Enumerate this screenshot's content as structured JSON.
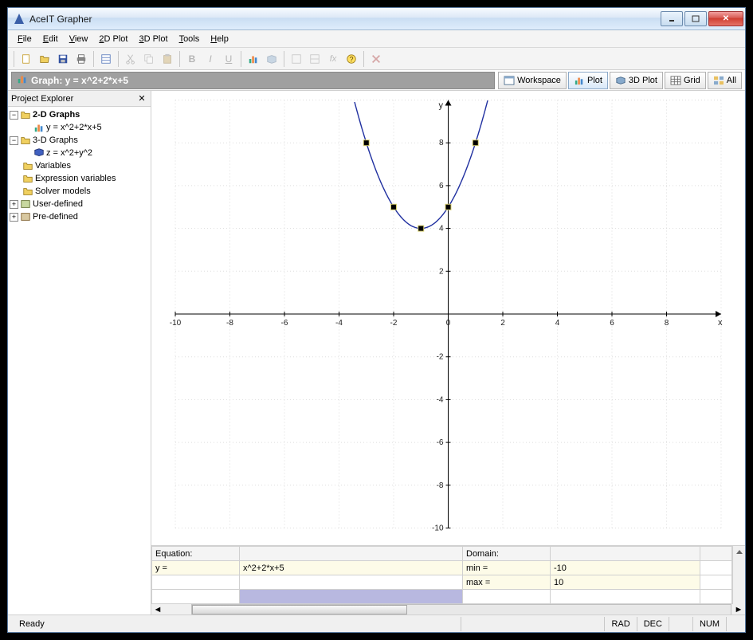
{
  "window": {
    "title": "AceIT Grapher"
  },
  "menu": {
    "file": "File",
    "edit": "Edit",
    "view": "View",
    "plot2d": "2D Plot",
    "plot3d": "3D Plot",
    "tools": "Tools",
    "help": "Help"
  },
  "graph_header": {
    "label": "Graph: y = x^2+2*x+5"
  },
  "view_buttons": {
    "workspace": "Workspace",
    "plot": "Plot",
    "plot3d": "3D Plot",
    "grid": "Grid",
    "all": "All"
  },
  "sidebar": {
    "title": "Project Explorer",
    "nodes": {
      "g2d": "2-D Graphs",
      "eq1": "y = x^2+2*x+5",
      "g3d": "3-D Graphs",
      "eq2": "z = x^2+y^2",
      "vars": "Variables",
      "expvars": "Expression variables",
      "solver": "Solver models",
      "userdef": "User-defined",
      "predef": "Pre-defined"
    }
  },
  "equation_panel": {
    "eq_label": "Equation:",
    "y_label": "y =",
    "expression": "x^2+2*x+5",
    "domain_label": "Domain:",
    "min_label": "min =",
    "min_value": "-10",
    "max_label": "max =",
    "max_value": "10"
  },
  "status": {
    "ready": "Ready",
    "rad": "RAD",
    "dec": "DEC",
    "num": "NUM"
  },
  "chart_data": {
    "type": "line",
    "title": "",
    "xlabel": "x",
    "ylabel": "y",
    "xlim": [
      -10,
      10
    ],
    "ylim": [
      -10,
      10
    ],
    "x_ticks": [
      -10,
      -8,
      -6,
      -4,
      -2,
      0,
      2,
      4,
      6,
      8
    ],
    "y_ticks": [
      -10,
      -8,
      -6,
      -4,
      -2,
      2,
      4,
      6,
      8
    ],
    "series": [
      {
        "name": "y = x^2+2*x+5",
        "function": "x^2+2*x+5",
        "color": "#2030a0"
      }
    ],
    "control_points": [
      {
        "x": -3,
        "y": 8
      },
      {
        "x": -2,
        "y": 5
      },
      {
        "x": -1,
        "y": 4
      },
      {
        "x": 0,
        "y": 5
      },
      {
        "x": 1,
        "y": 8
      }
    ]
  }
}
